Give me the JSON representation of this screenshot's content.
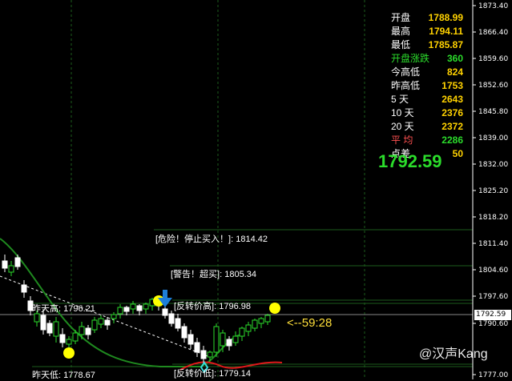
{
  "price_axis": {
    "ticks": [
      "1873.40",
      "1866.40",
      "1859.60",
      "1852.60",
      "1845.80",
      "1839.00",
      "1832.00",
      "1825.20",
      "1818.20",
      "1811.40",
      "1804.60",
      "1797.60",
      "1790.60",
      "1777.00"
    ],
    "current_price_tag": "1792.59"
  },
  "info_panel": {
    "rows": [
      {
        "label": "开盘",
        "value": "1788.99",
        "label_color": "#ffffff",
        "value_color": "#ffd200"
      },
      {
        "label": "最高",
        "value": "1794.11",
        "label_color": "#ffffff",
        "value_color": "#ffd200"
      },
      {
        "label": "最低",
        "value": "1785.87",
        "label_color": "#ffffff",
        "value_color": "#ffd200"
      },
      {
        "label": "开盘涨跌",
        "value": "360",
        "label_color": "#2bdc2b",
        "value_color": "#2bdc2b"
      },
      {
        "label": "今高低",
        "value": "824",
        "label_color": "#ffffff",
        "value_color": "#ffd200"
      },
      {
        "label": "昨高低",
        "value": "1753",
        "label_color": "#ffffff",
        "value_color": "#ffd200"
      },
      {
        "label": "5  天",
        "value": "2643",
        "label_color": "#ffffff",
        "value_color": "#ffd200"
      },
      {
        "label": "10  天",
        "value": "2376",
        "label_color": "#ffffff",
        "value_color": "#ffd200"
      },
      {
        "label": "20  天",
        "value": "2372",
        "label_color": "#ffffff",
        "value_color": "#ffd200"
      },
      {
        "label": "平  均",
        "value": "2286",
        "label_color": "#ff5050",
        "value_color": "#2bdc2b"
      },
      {
        "label": "点差",
        "value": "50",
        "label_color": "#ffffff",
        "value_color": "#ffd200"
      }
    ],
    "big_price": "1792.59"
  },
  "annotations": {
    "danger": "[危险！停止买入！]: 1814.42",
    "warning": "[警告！超买]: 1805.34",
    "yesterday_high": "昨天高: 1796.21",
    "reversal_high": "[反转价高]: 1796.98",
    "yesterday_low": "昨天低: 1778.67",
    "reversal_low": "[反转价低]: 1779.14"
  },
  "timer": "<--59:28",
  "watermark": "@汉声Kang",
  "colors": {
    "bull": "#2bdc2b",
    "bear": "#ffffff",
    "ma": "#1f8a1f",
    "vline": "#1d5c1d",
    "hline": "#1d5c1d",
    "red_curve": "#e0191b",
    "yellow_dot": "#ffff00",
    "arrow": "#1e7fd8"
  }
}
